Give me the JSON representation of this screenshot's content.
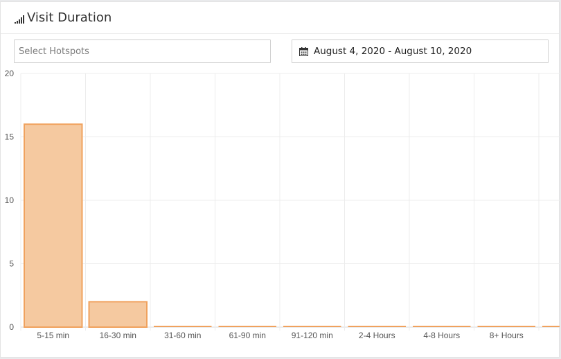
{
  "header": {
    "title": "Visit Duration",
    "icon": "signal-bars-icon"
  },
  "filters": {
    "hotspots_placeholder": "Select Hotspots",
    "date_range": "August 4, 2020 - August 10, 2020",
    "date_icon": "calendar-icon"
  },
  "colors": {
    "bar_fill": "#f5c9a0",
    "bar_border": "#f0a25e",
    "grid": "#ececec",
    "axis": "#d9d9d9"
  },
  "chart_data": {
    "type": "bar",
    "categories": [
      "5-15 min",
      "16-30 min",
      "31-60 min",
      "61-90 min",
      "91-120 min",
      "2-4 Hours",
      "4-8 Hours",
      "8+ Hours",
      ""
    ],
    "values": [
      16,
      2,
      0,
      0,
      0,
      0,
      0,
      0,
      0
    ],
    "yticks": [
      "0",
      "5",
      "10",
      "15",
      "20"
    ],
    "ylim": [
      0,
      20
    ],
    "grid": true,
    "legend": "none"
  }
}
